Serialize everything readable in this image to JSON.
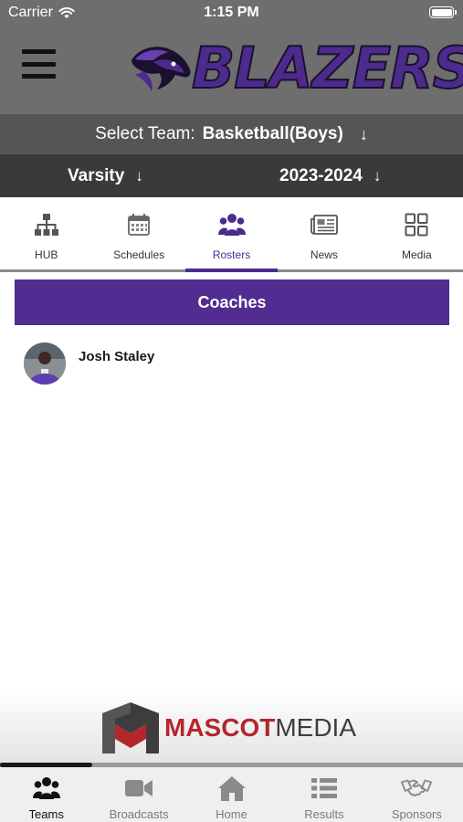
{
  "status_bar": {
    "carrier": "Carrier",
    "time": "1:15 PM"
  },
  "header": {
    "brand_name": "BLAZERS"
  },
  "team_selector": {
    "label": "Select Team:",
    "value": "Basketball(Boys)"
  },
  "filters": {
    "level": "Varsity",
    "season": "2023-2024"
  },
  "tabs": [
    {
      "label": "HUB",
      "icon": "hierarchy-icon"
    },
    {
      "label": "Schedules",
      "icon": "calendar-icon"
    },
    {
      "label": "Rosters",
      "icon": "people-icon",
      "active": true
    },
    {
      "label": "News",
      "icon": "newspaper-icon"
    },
    {
      "label": "Media",
      "icon": "grid-icon"
    }
  ],
  "section": {
    "title": "Coaches"
  },
  "coaches": [
    {
      "name": "Josh Staley"
    }
  ],
  "sponsor": {
    "part1": "MASCOT",
    "part2": "MEDIA"
  },
  "bottom_nav": [
    {
      "label": "Teams",
      "icon": "people-icon",
      "active": true
    },
    {
      "label": "Broadcasts",
      "icon": "video-camera-icon"
    },
    {
      "label": "Home",
      "icon": "home-icon"
    },
    {
      "label": "Results",
      "icon": "list-icon"
    },
    {
      "label": "Sponsors",
      "icon": "handshake-icon"
    }
  ],
  "colors": {
    "accent": "#512c91",
    "header_gray": "#6e6e6e",
    "select_bar": "#555555",
    "filter_bar": "#3a3a3a"
  },
  "scroll_progress": 0.2
}
